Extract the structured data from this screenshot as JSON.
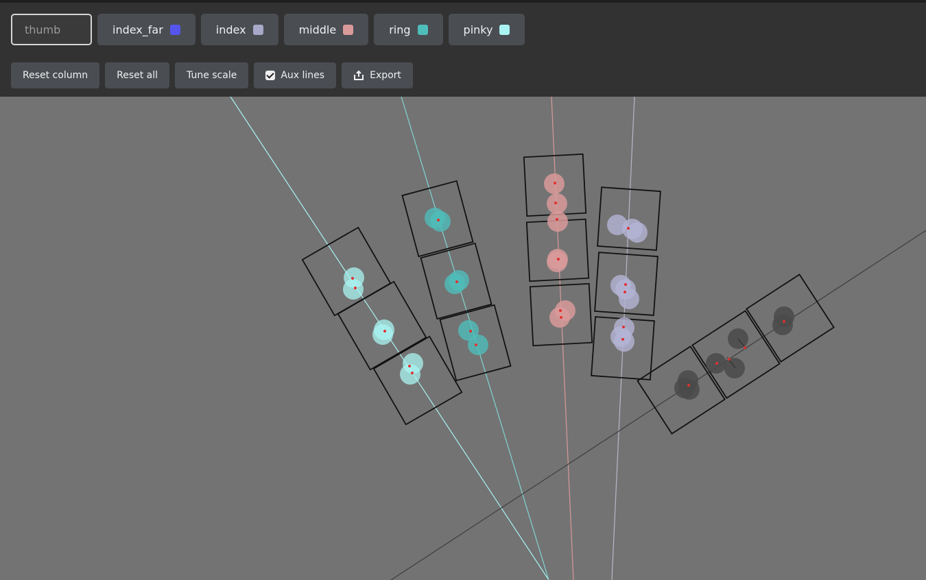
{
  "tabs": [
    {
      "label": "thumb",
      "color": null,
      "active": true
    },
    {
      "label": "index_far",
      "color": "#5555ee"
    },
    {
      "label": "index",
      "color": "#a8a8c8"
    },
    {
      "label": "middle",
      "color": "#d99a9a"
    },
    {
      "label": "ring",
      "color": "#4fbdba"
    },
    {
      "label": "pinky",
      "color": "#a9f4f2"
    }
  ],
  "actions": {
    "reset_column": "Reset column",
    "reset_all": "Reset all",
    "tune_scale": "Tune scale",
    "aux_lines": "Aux lines",
    "aux_lines_checked": true,
    "export": "Export"
  },
  "icons": {
    "checkbox": "checkmark-icon",
    "export": "export-icon"
  }
}
